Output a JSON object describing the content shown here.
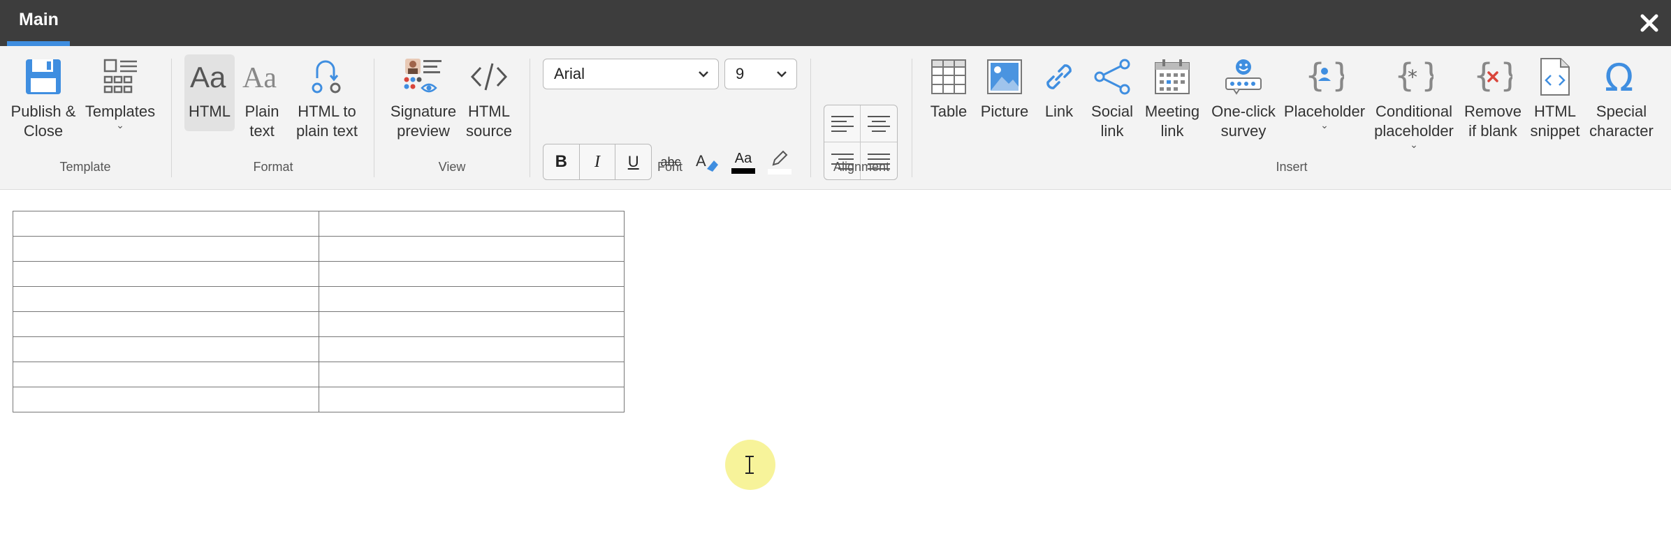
{
  "titlebar": {
    "tab": "Main",
    "close_icon": "close-icon"
  },
  "groups": {
    "template": "Template",
    "format": "Format",
    "view": "View",
    "font": "Font",
    "alignment": "Alignment",
    "insert": "Insert"
  },
  "template": {
    "publish": [
      "Publish &",
      "Close"
    ],
    "templates": "Templates"
  },
  "format": {
    "html": "HTML",
    "plain": [
      "Plain",
      "text"
    ],
    "html_to_plain": [
      "HTML to",
      "plain text"
    ]
  },
  "view": {
    "signature": [
      "Signature",
      "preview"
    ],
    "source": [
      "HTML",
      "source"
    ]
  },
  "font": {
    "family": "Arial",
    "size": "9",
    "bold": "B",
    "italic": "I",
    "underline": "U",
    "strike": "abc",
    "font_color": "Aa",
    "font_color_value": "#000000"
  },
  "insert": {
    "table": "Table",
    "picture": "Picture",
    "link": "Link",
    "social": [
      "Social",
      "link"
    ],
    "meeting": [
      "Meeting",
      "link"
    ],
    "survey": [
      "One-click",
      "survey"
    ],
    "placeholder": "Placeholder",
    "conditional": [
      "Conditional",
      "placeholder"
    ],
    "remove": [
      "Remove",
      "if blank"
    ],
    "snippet": [
      "HTML",
      "snippet"
    ],
    "special": [
      "Special",
      "character"
    ]
  },
  "colors": {
    "accent": "#3f8ee0",
    "titlebar": "#3d3d3d",
    "ribbon": "#f3f3f3"
  },
  "document": {
    "table_rows": 8,
    "table_cols": 2
  }
}
